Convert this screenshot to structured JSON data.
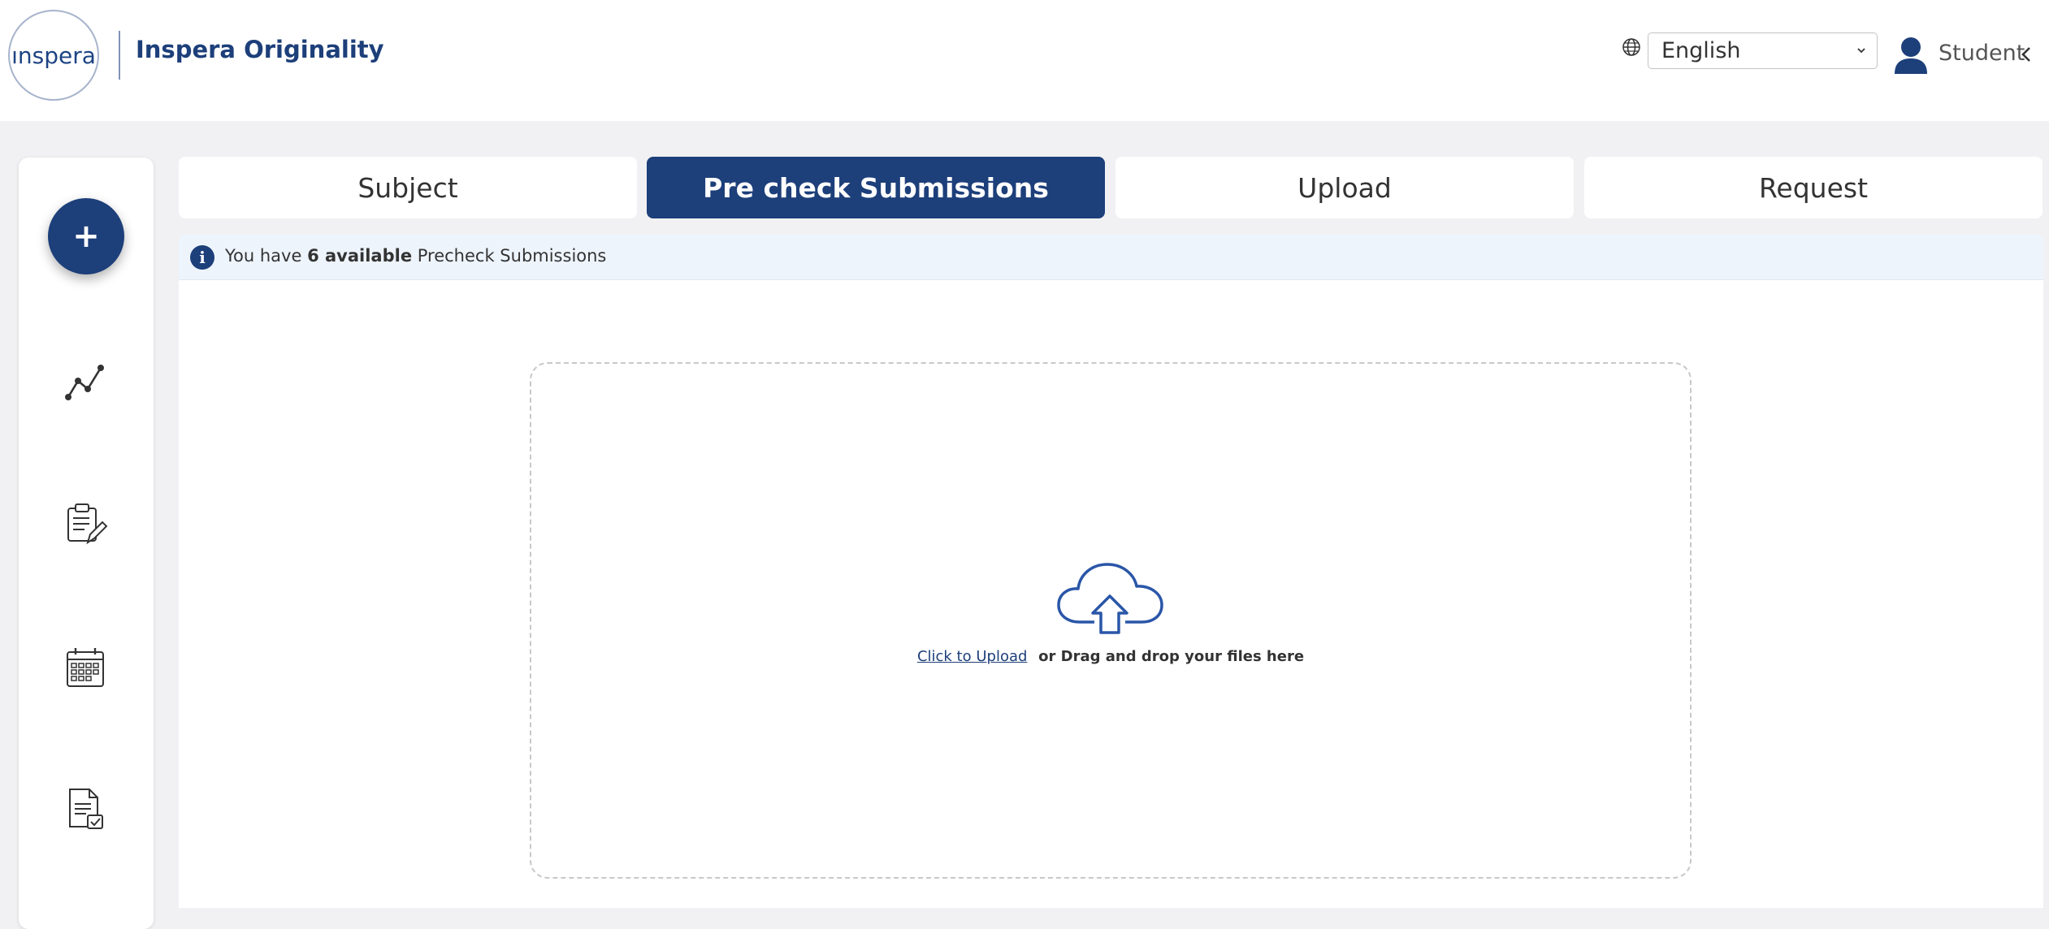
{
  "header": {
    "logo_text": "ınspera",
    "app_title": "Inspera Originality",
    "language": {
      "selected": "English",
      "icon": "globe-icon"
    },
    "user": {
      "label": "Student",
      "icon": "user-icon"
    }
  },
  "sidebar": {
    "fab_label": "+",
    "items": [
      {
        "icon": "analytics-icon"
      },
      {
        "icon": "clipboard-edit-icon"
      },
      {
        "icon": "calendar-icon"
      },
      {
        "icon": "document-check-icon"
      }
    ]
  },
  "tabs": [
    {
      "label": "Subject",
      "active": false
    },
    {
      "label": "Pre check Submissions",
      "active": true
    },
    {
      "label": "Upload",
      "active": false
    },
    {
      "label": "Request",
      "active": false
    }
  ],
  "info": {
    "prefix": "You have ",
    "count_text": "6 available",
    "suffix": " Precheck Submissions",
    "icon_glyph": "i"
  },
  "upload": {
    "link_label": "Click to Upload",
    "rest_label": "or Drag and drop your files here",
    "icon": "cloud-upload-icon"
  },
  "colors": {
    "brand": "#1d3f7a",
    "background": "#f1f1f3",
    "info_bar": "#eef4fc"
  }
}
